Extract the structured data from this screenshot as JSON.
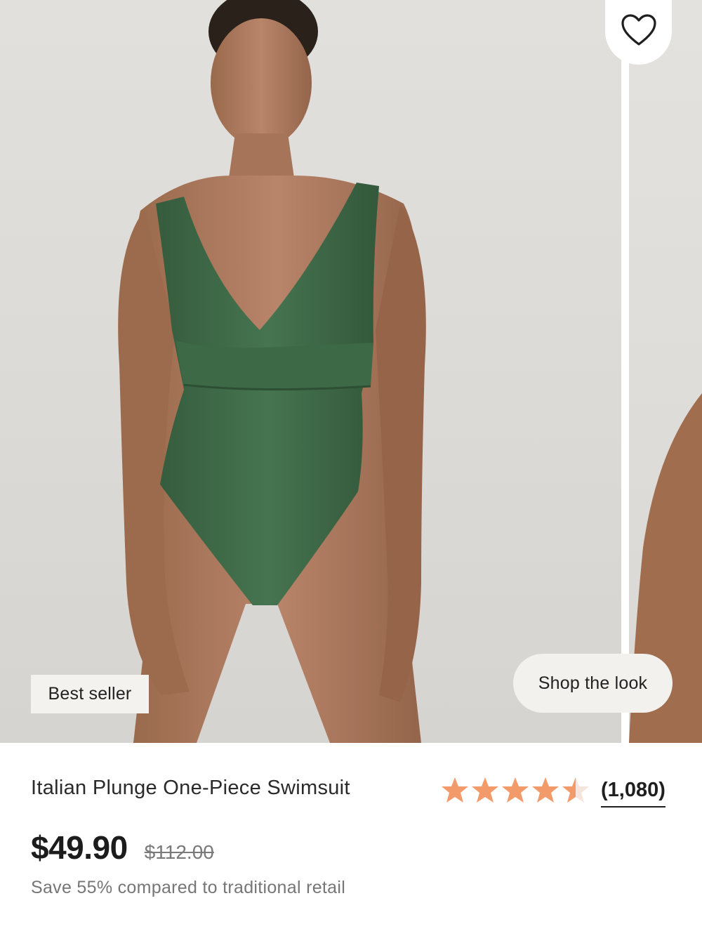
{
  "product": {
    "badge": "Best seller",
    "shop_the_look": "Shop the look",
    "name": "Italian Plunge One-Piece Swimsuit",
    "rating": 4.5,
    "rating_max": 5,
    "review_count": "(1,080)",
    "price": "$49.90",
    "compare_price": "$112.00",
    "savings_note": "Save 55% compared to traditional retail"
  },
  "colors": {
    "star": "#f39a6b",
    "swimsuit": "#3f6b48",
    "background": "#dedcd8"
  },
  "icons": {
    "wishlist": "heart-outline-icon"
  }
}
